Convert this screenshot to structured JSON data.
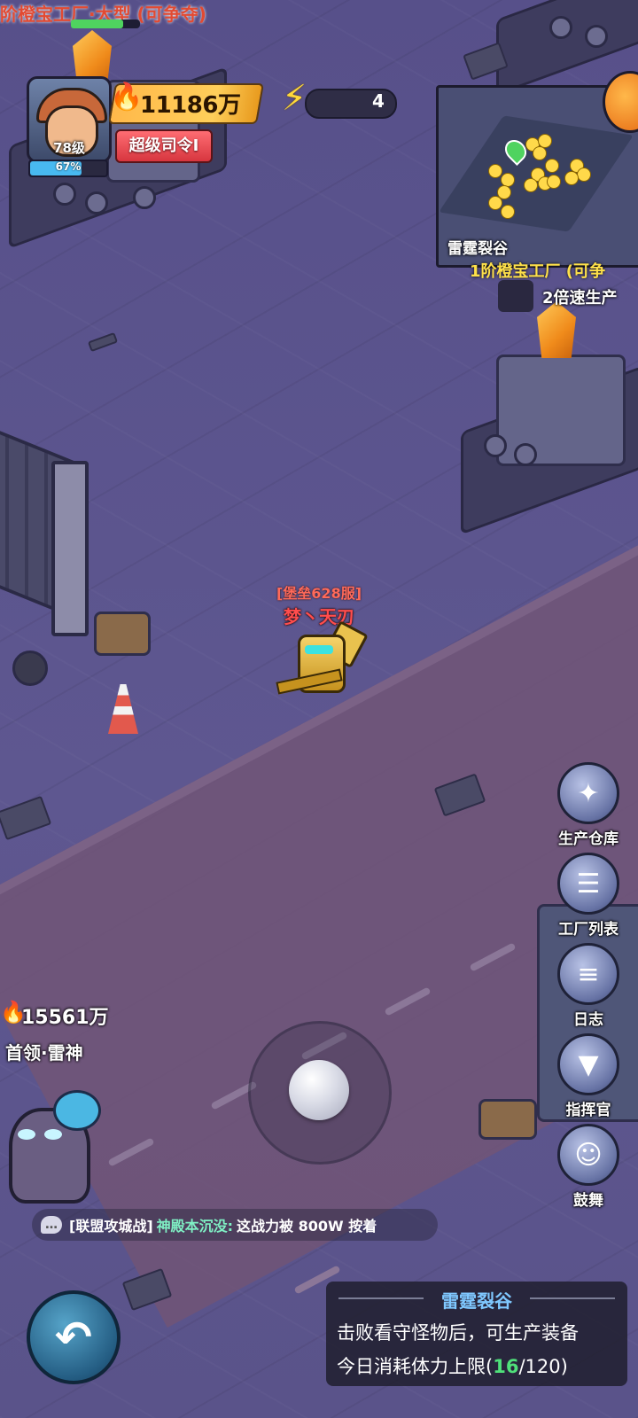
{
  "top_banner": {
    "text": "阶橙宝工厂·大型 (可争夺)"
  },
  "player_hud": {
    "level_label": "78级",
    "xp_percent_label": "67%",
    "xp_percent": 67,
    "power": "11186万",
    "rank": "超级司令Ⅰ",
    "energy": "4"
  },
  "minimap": {
    "area_name": "雷霆裂谷"
  },
  "building": {
    "title": "1阶橙宝工厂 (可争",
    "status": "2倍速生产"
  },
  "player_character": {
    "server": "[堡垒628服]",
    "name": "梦丶天刃"
  },
  "boss": {
    "power": "15561万",
    "name": "首领·雷神"
  },
  "side_buttons": [
    {
      "label": "生产仓库",
      "icon": "warehouse-icon"
    },
    {
      "label": "工厂列表",
      "icon": "factory-list-icon"
    },
    {
      "label": "日志",
      "icon": "log-icon"
    },
    {
      "label": "指挥官",
      "icon": "commander-icon"
    },
    {
      "label": "鼓舞",
      "icon": "inspire-icon"
    }
  ],
  "chat": {
    "channel": "[联盟攻城战]",
    "user": "神殿本沉没:",
    "message": "这战力被 800W 按着"
  },
  "info_panel": {
    "title": "雷霆裂谷",
    "desc": "击败看守怪物后，可生产装备",
    "limit_prefix": "今日消耗体力上限(",
    "limit_current": "16",
    "limit_suffix": "/120)"
  },
  "colors": {
    "accent_power": "#ffcf5a",
    "rank_red": "#d7363f",
    "chat_user": "#7ff0c4",
    "info_title": "#7fc8ff"
  }
}
